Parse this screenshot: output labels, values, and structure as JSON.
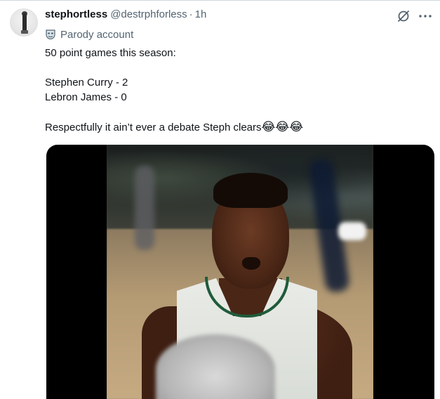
{
  "tweet": {
    "display_name": "stephortless",
    "handle": "@destrphforless",
    "separator": "·",
    "time": "1h",
    "parody_label": "Parody account",
    "lines": [
      "50 point games this season:",
      "",
      "Stephen Curry - 2",
      "Lebron James - 0",
      "",
      "Respectfully it ain’t ever a debate Steph clears"
    ],
    "emojis": "😂😂😂"
  },
  "icons": {
    "avatar": "profile-avatar",
    "parody": "mask-icon",
    "grok": "grok-icon",
    "more": "more-horizontal-icon"
  },
  "colors": {
    "text": "#0f1419",
    "secondary": "#536471",
    "border": "#cfd9de",
    "media_bg": "#000000"
  }
}
